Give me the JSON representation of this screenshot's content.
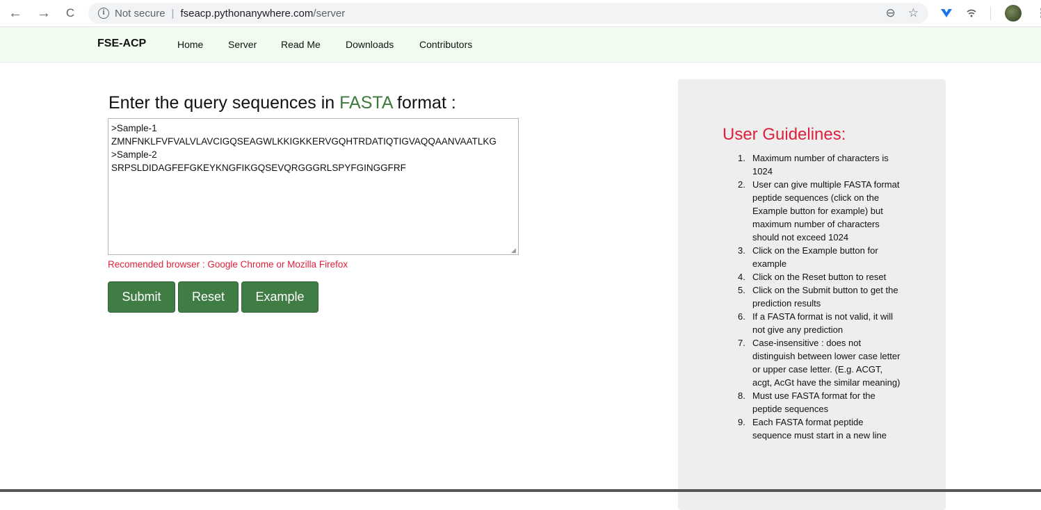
{
  "browser": {
    "back_glyph": "←",
    "forward_glyph": "→",
    "reload_glyph": "C",
    "security_label": "Not secure",
    "url_host": "fseacp.pythonanywhere.com",
    "url_path": "/server",
    "zoom_glyph": "⊖",
    "star_glyph": "☆"
  },
  "navbar": {
    "brand": "FSE-ACP",
    "links": [
      "Home",
      "Server",
      "Read Me",
      "Downloads",
      "Contributors"
    ]
  },
  "main": {
    "heading_prefix": "Enter the query sequences in ",
    "heading_fasta": "FASTA",
    "heading_suffix": " format :",
    "sequence_text": ">Sample-1\nZMNFNKLFVFVALVLAVCIGQSEAGWLKKIGKKERVGQHTRDATIQTIGVAQQAANVAATLKG\n>Sample-2\nSRPSLDIDAGFEFGKEYKNGFIKGQSEVQRGGGRLSPYFGINGGFRF",
    "browser_note": "Recomended browser : Google Chrome or Mozilla Firefox",
    "buttons": {
      "submit": "Submit",
      "reset": "Reset",
      "example": "Example"
    }
  },
  "guidelines": {
    "title": "User Guidelines:",
    "items": [
      "Maximum number of characters is 1024",
      "User can give multiple FASTA format peptide sequences (click on the Example button for example) but maximum number of characters should not exceed 1024",
      "Click on the Example button for example",
      "Click on the Reset button to reset",
      "Click on the Submit button to get the prediction results",
      "If a FASTA format is not valid, it will not give any prediction",
      "Case-insensitive : does not distinguish between lower case letter or upper case letter. (E.g. ACGT, acgt, AcGt have the similar meaning)",
      "Must use FASTA format for the peptide sequences",
      "Each FASTA format peptide sequence must start in a new line"
    ]
  },
  "colors": {
    "accent_green": "#3f7d45",
    "alert_red": "#e0203a",
    "navbar_bg": "#f0fdf0",
    "panel_bg": "#eeeeee"
  }
}
